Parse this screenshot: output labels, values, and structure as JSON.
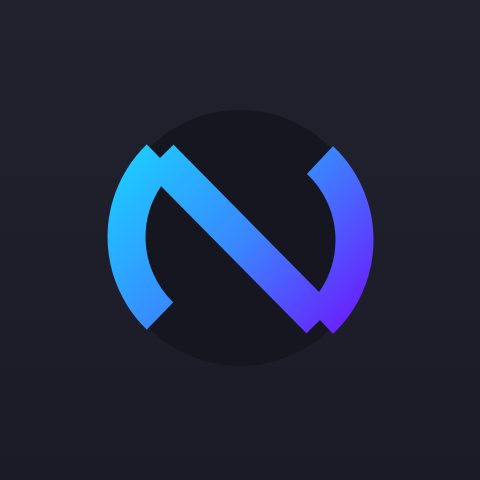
{
  "icon": {
    "semantic_name": "letter-n-ring-logo-icon",
    "colors": {
      "background_top": "#22222f",
      "background_bottom": "#1b1b27",
      "disc": "#161620",
      "gradient_start": "#1ec8ff",
      "gradient_mid": "#3a86ff",
      "gradient_end": "#6a1dff"
    }
  }
}
